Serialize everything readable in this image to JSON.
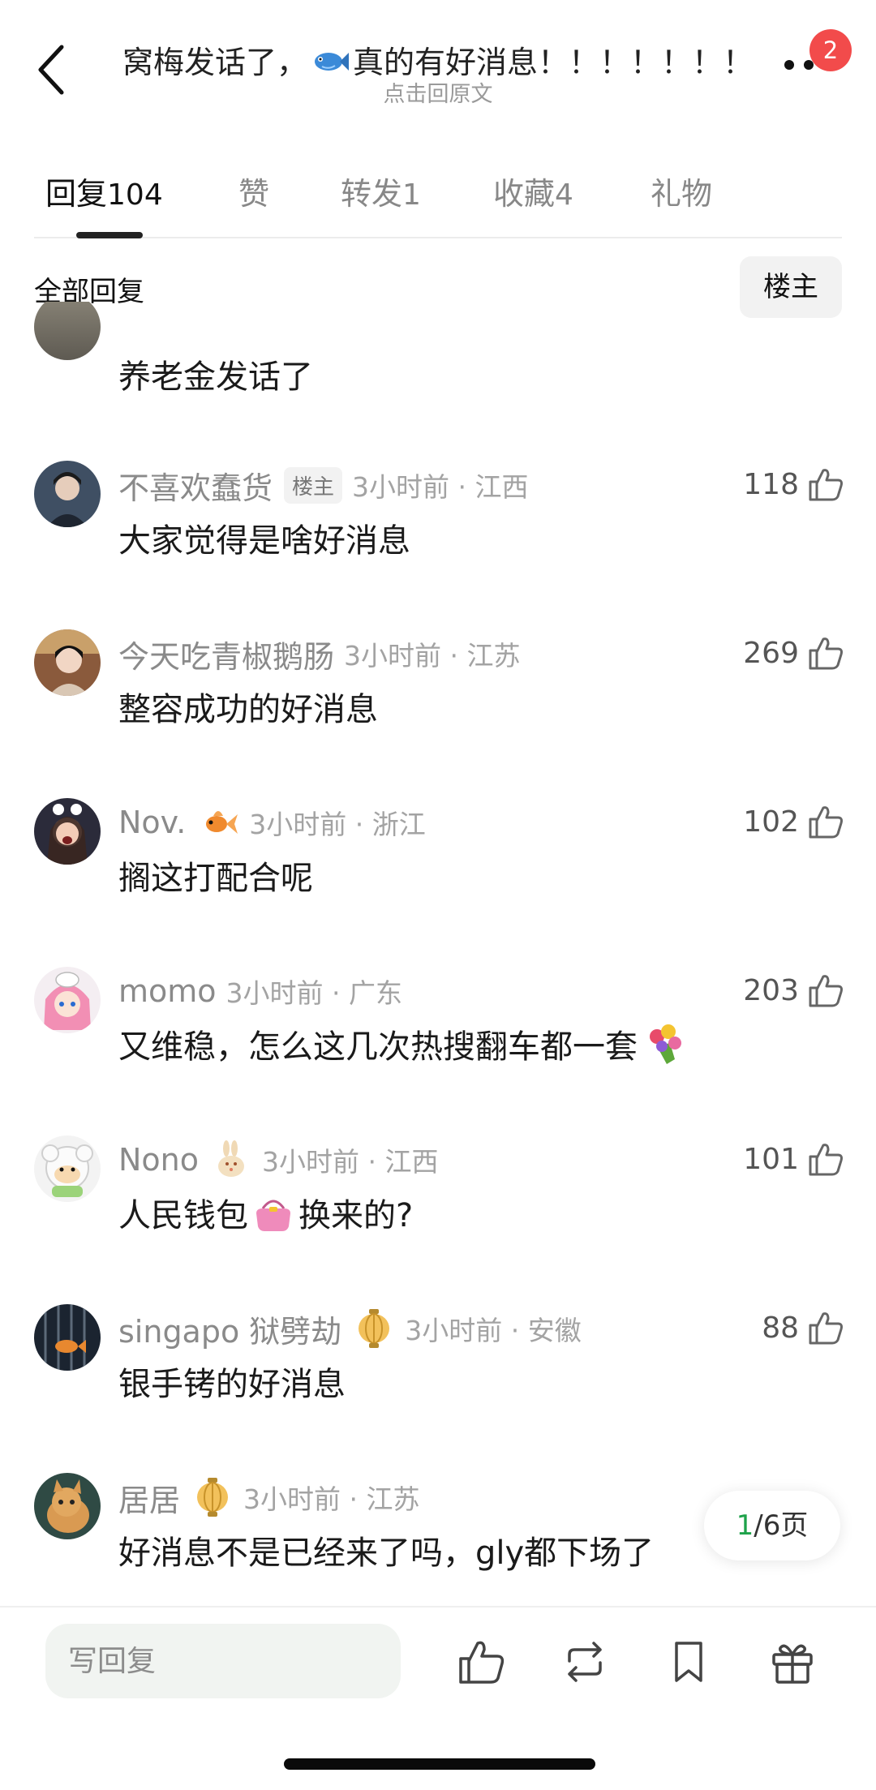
{
  "header": {
    "title_before": "窝梅发话了，",
    "title_emoji": "fish-emoji",
    "title_after": "真的有好消息！！！！！！！",
    "subtitle": "点击回原文",
    "notification_count": "2"
  },
  "tabs": [
    {
      "label": "回复",
      "count": "104"
    },
    {
      "label": "赞",
      "count": ""
    },
    {
      "label": "转发",
      "count": "1"
    },
    {
      "label": "收藏",
      "count": "4"
    },
    {
      "label": "礼物",
      "count": ""
    }
  ],
  "filter": {
    "all_label": "全部回复",
    "op_label": "楼主"
  },
  "cut_comment": {
    "text": "养老金发话了"
  },
  "comments": [
    {
      "name": "不喜欢蠢货",
      "tag": "楼主",
      "meta": "3小时前 · 江西",
      "likes": "118",
      "text": "大家觉得是啥好消息"
    },
    {
      "name": "今天吃青椒鹅肠",
      "meta": "3小时前 · 江苏",
      "likes": "269",
      "text": "整容成功的好消息"
    },
    {
      "name": "Nov.",
      "badge": "goldfish-icon",
      "meta": "3小时前 · 浙江",
      "likes": "102",
      "text": "搁这打配合呢"
    },
    {
      "name": "momo",
      "meta": "3小时前 · 广东",
      "likes": "203",
      "text": "又维稳，怎么这几次热搜翻车都一套",
      "emoji": "bouquet-emoji"
    },
    {
      "name": "Nono",
      "badge": "rabbit-icon",
      "meta": "3小时前 · 江西",
      "likes": "101",
      "text_before": "人民钱包",
      "emoji": "purse-emoji",
      "text_after": "换来的?"
    },
    {
      "name": "singapo 狱劈劫",
      "badge": "lantern-icon",
      "meta": "3小时前 · 安徽",
      "likes": "88",
      "text": "银手铐的好消息"
    },
    {
      "name": "居居",
      "badge": "lantern-icon",
      "meta": "3小时前 · 江苏",
      "likes": "",
      "text": "好消息不是已经来了吗，gly都下场了"
    }
  ],
  "pager": {
    "current": "1",
    "total": "/6页"
  },
  "bottom_bar": {
    "reply_placeholder": "写回复"
  },
  "colors": {
    "accent_green": "#1ea24a",
    "badge_red": "#f24b4b"
  }
}
